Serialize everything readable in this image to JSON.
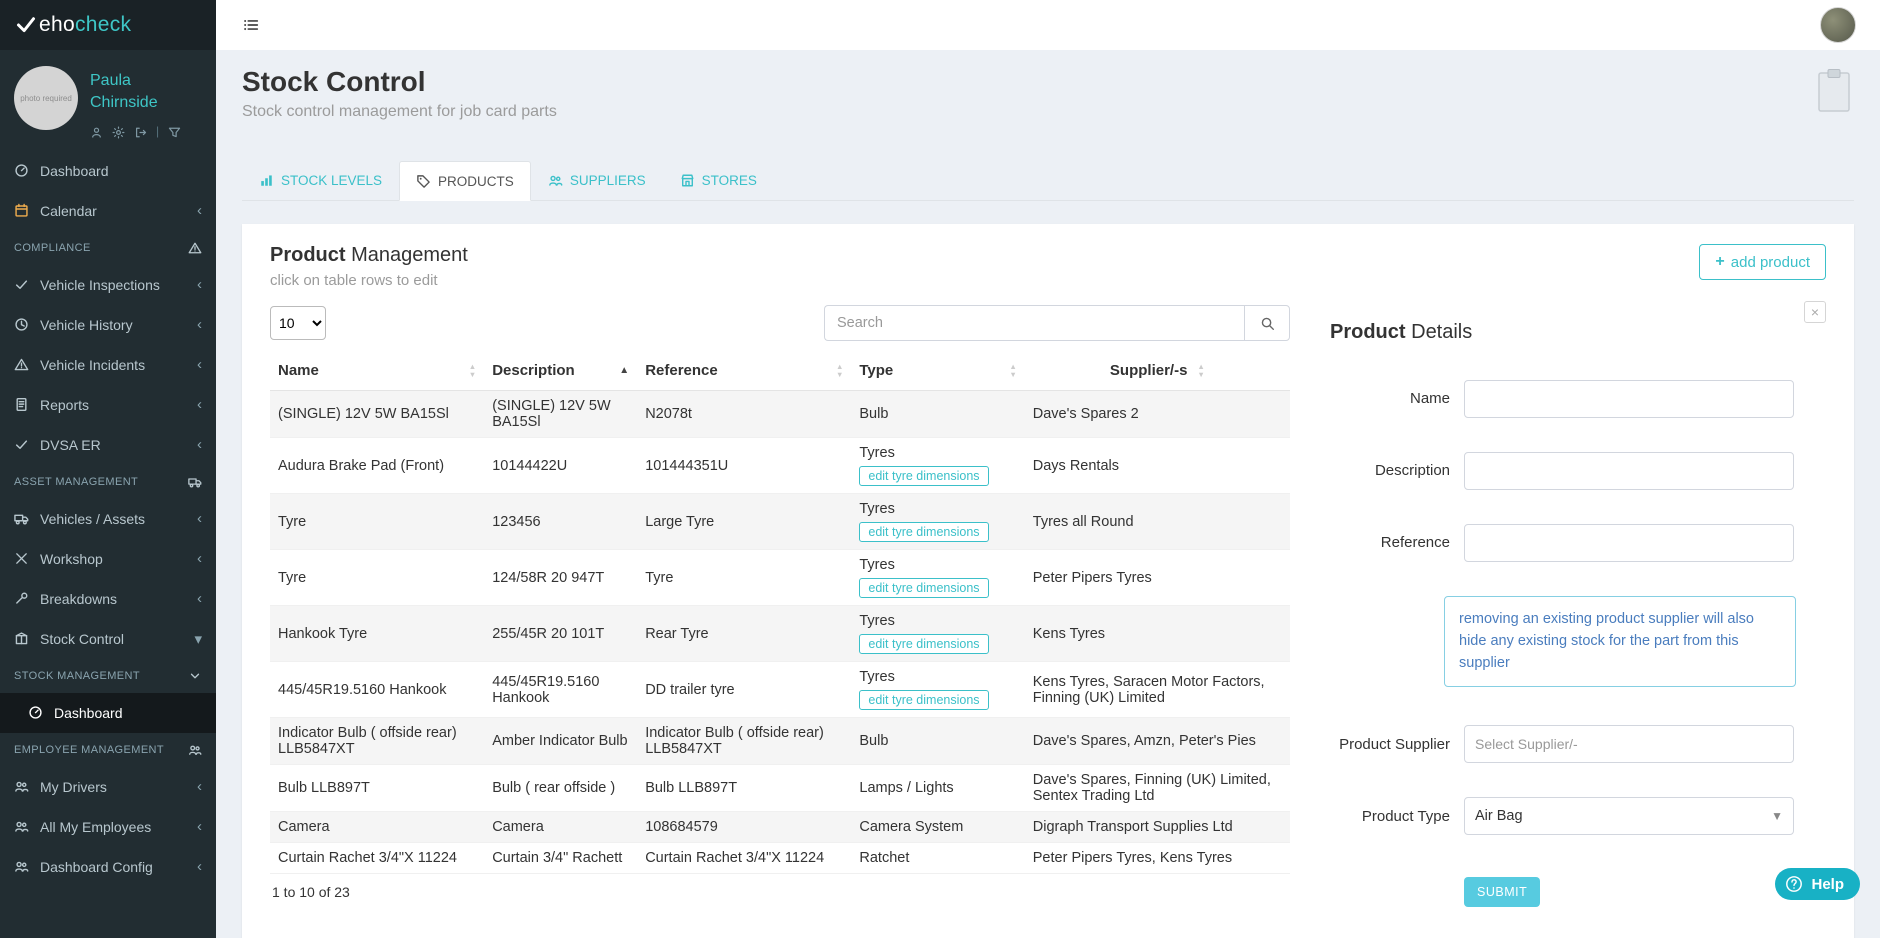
{
  "colors": {
    "accent": "#3bc0c9",
    "sidebar_bg": "#222d32",
    "submit": "#57cbe0",
    "help": "#18b1c5"
  },
  "brand": {
    "name_white": "eho",
    "name_accent": "check"
  },
  "sidebar": {
    "profile": {
      "first_name": "Paula",
      "last_name": "Chirnside",
      "avatar_text": "photo required"
    },
    "menu": [
      {
        "type": "item",
        "label": "Dashboard",
        "icon": "gauge",
        "chevron": ""
      },
      {
        "type": "item",
        "label": "Calendar",
        "icon": "calendar",
        "icon_color": "#f0ad4e",
        "chevron": "left"
      },
      {
        "type": "header",
        "label": "COMPLIANCE",
        "icon": "warning"
      },
      {
        "type": "item",
        "label": "Vehicle Inspections",
        "icon": "check",
        "chevron": "left"
      },
      {
        "type": "item",
        "label": "Vehicle History",
        "icon": "clock",
        "chevron": "left"
      },
      {
        "type": "item",
        "label": "Vehicle Incidents",
        "icon": "warning",
        "chevron": "left"
      },
      {
        "type": "item",
        "label": "Reports",
        "icon": "doc",
        "chevron": "left"
      },
      {
        "type": "item",
        "label": "DVSA ER",
        "icon": "check",
        "chevron": "left"
      },
      {
        "type": "header",
        "label": "ASSET MANAGEMENT",
        "icon": "truck"
      },
      {
        "type": "item",
        "label": "Vehicles / Assets",
        "icon": "truck",
        "chevron": "left"
      },
      {
        "type": "item",
        "label": "Workshop",
        "icon": "tools",
        "chevron": "left"
      },
      {
        "type": "item",
        "label": "Breakdowns",
        "icon": "wrench",
        "chevron": "left"
      },
      {
        "type": "item",
        "label": "Stock Control",
        "icon": "box",
        "chevron": "down"
      },
      {
        "type": "header",
        "label": "STOCK MANAGEMENT",
        "icon": "chevdown"
      },
      {
        "type": "subitem",
        "label": "Dashboard",
        "icon": "gauge",
        "active": true
      },
      {
        "type": "header",
        "label": "EMPLOYEE MANAGEMENT",
        "icon": "users"
      },
      {
        "type": "item",
        "label": "My Drivers",
        "icon": "users",
        "chevron": "left"
      },
      {
        "type": "item",
        "label": "All My Employees",
        "icon": "users",
        "chevron": "left"
      },
      {
        "type": "item",
        "label": "Dashboard Config",
        "icon": "users",
        "chevron": "left"
      }
    ]
  },
  "page": {
    "title": "Stock Control",
    "subtitle": "Stock control management for job card parts"
  },
  "tabs": [
    {
      "label": "STOCK LEVELS",
      "icon": "chart",
      "active": false
    },
    {
      "label": "PRODUCTS",
      "icon": "tag",
      "active": true
    },
    {
      "label": "SUPPLIERS",
      "icon": "users",
      "active": false
    },
    {
      "label": "STORES",
      "icon": "store",
      "active": false
    }
  ],
  "product_management": {
    "title_bold": "Product",
    "title_rest": " Management",
    "subtitle": "click on table rows to edit",
    "add_button": "add product",
    "page_size": "10",
    "search_placeholder": "Search",
    "pagination_info": "1 to 10 of 23",
    "table": {
      "columns": [
        "Name",
        "Description",
        "Reference",
        "Type",
        "Supplier/-s"
      ],
      "sorted_column": "Description",
      "sort_dir": "asc",
      "rows": [
        {
          "name": "(SINGLE) 12V 5W BA15Sl",
          "description": "(SINGLE) 12V 5W BA15Sl",
          "reference": "N2078t",
          "type": "Bulb",
          "type_button": null,
          "suppliers": "Dave's Spares 2"
        },
        {
          "name": "Audura Brake Pad (Front)",
          "description": "10144422U",
          "reference": "101444351U",
          "type": "Tyres",
          "type_button": "edit tyre dimensions",
          "suppliers": "Days Rentals"
        },
        {
          "name": "Tyre",
          "description": "123456",
          "reference": "Large Tyre",
          "type": "Tyres",
          "type_button": "edit tyre dimensions",
          "suppliers": "Tyres all Round"
        },
        {
          "name": "Tyre",
          "description": "124/58R 20 947T",
          "reference": "Tyre",
          "type": "Tyres",
          "type_button": "edit tyre dimensions",
          "suppliers": "Peter Pipers Tyres"
        },
        {
          "name": "Hankook Tyre",
          "description": "255/45R 20 101T",
          "reference": "Rear Tyre",
          "type": "Tyres",
          "type_button": "edit tyre dimensions",
          "suppliers": "Kens Tyres"
        },
        {
          "name": "445/45R19.5160 Hankook",
          "description": "445/45R19.5160 Hankook",
          "reference": "DD trailer tyre",
          "type": "Tyres",
          "type_button": "edit tyre dimensions",
          "suppliers": "Kens Tyres, Saracen Motor Factors, Finning (UK) Limited"
        },
        {
          "name": "Indicator Bulb ( offside rear) LLB5847XT",
          "description": "Amber Indicator Bulb",
          "reference": "Indicator Bulb ( offside rear) LLB5847XT",
          "type": "Bulb",
          "type_button": null,
          "suppliers": "Dave's Spares, Amzn, Peter's Pies"
        },
        {
          "name": "Bulb LLB897T",
          "description": "Bulb ( rear offside )",
          "reference": "Bulb LLB897T",
          "type": "Lamps / Lights",
          "type_button": null,
          "suppliers": "Dave's Spares, Finning (UK) Limited, Sentex Trading Ltd"
        },
        {
          "name": "Camera",
          "description": "Camera",
          "reference": "108684579",
          "type": "Camera System",
          "type_button": null,
          "suppliers": "Digraph Transport Supplies Ltd"
        },
        {
          "name": "Curtain Rachet 3/4\"X 11224",
          "description": "Curtain 3/4\" Rachett",
          "reference": "Curtain Rachet 3/4\"X 11224",
          "type": "Ratchet",
          "type_button": null,
          "suppliers": "Peter Pipers Tyres, Kens Tyres"
        }
      ]
    }
  },
  "product_details": {
    "title_bold": "Product",
    "title_rest": " Details",
    "labels": [
      "Name",
      "Description",
      "Reference"
    ],
    "info_note": "removing an existing product supplier will also hide any existing stock for the part from this supplier",
    "supplier_label": "Product Supplier",
    "supplier_placeholder": "Select Supplier/-",
    "type_label": "Product Type",
    "type_value": "Air Bag",
    "submit_label": "SUBMIT",
    "close_label": "×"
  },
  "help_label": "Help"
}
